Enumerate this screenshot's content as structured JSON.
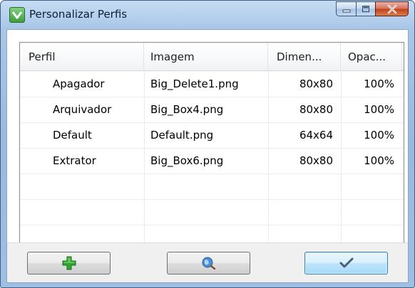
{
  "window": {
    "title": "Personalizar Perfis"
  },
  "table": {
    "columns": [
      "Perfil",
      "Imagem",
      "Dimen...",
      "Opac..."
    ],
    "rows": [
      [
        "Apagador",
        "Big_Delete1.png",
        "80x80",
        "100%"
      ],
      [
        "Arquivador",
        "Big_Box4.png",
        "80x80",
        "100%"
      ],
      [
        "Default",
        "Default.png",
        "64x64",
        "100%"
      ],
      [
        "Extrator",
        "Big_Box6.png",
        "80x80",
        "100%"
      ]
    ]
  },
  "buttons": {
    "add_icon": "plus-icon",
    "browse_icon": "globe-search-icon",
    "ok_icon": "checkmark-icon"
  },
  "colors": {
    "add_green": "#2fa52f",
    "accent_blue": "#3c7fb1",
    "close_red": "#c2401f"
  }
}
